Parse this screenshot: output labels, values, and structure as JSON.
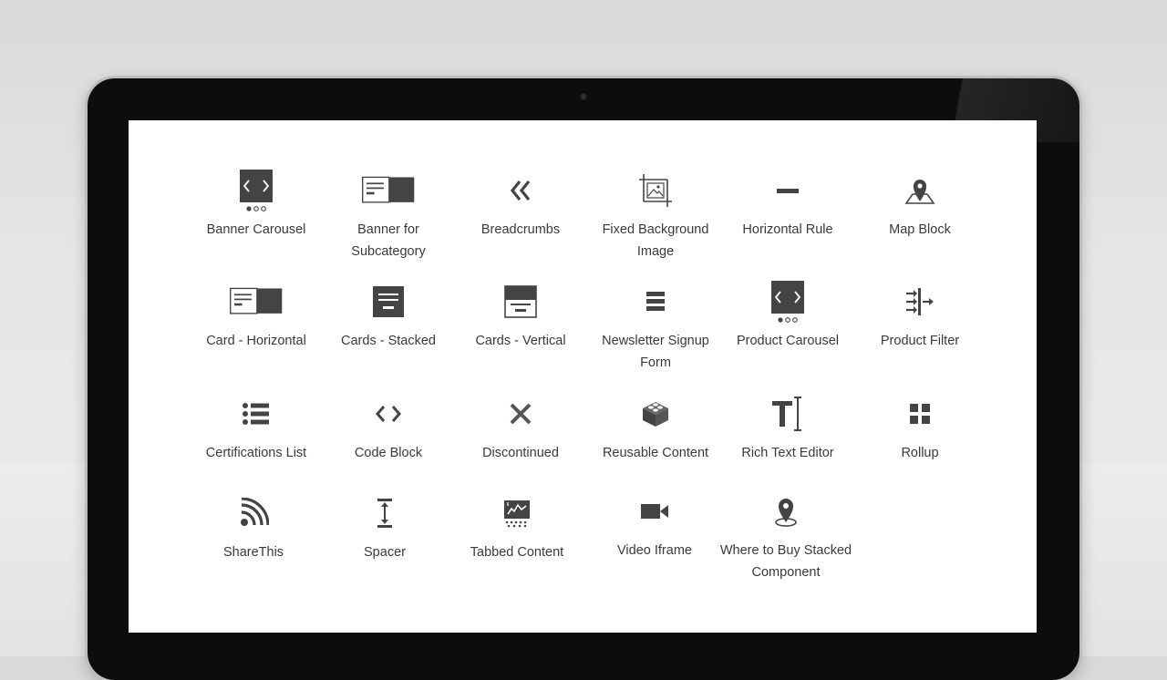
{
  "components": [
    {
      "label": "Banner Carousel",
      "icon": "carousel-icon"
    },
    {
      "label": "Banner for Subcategory",
      "icon": "banner-icon"
    },
    {
      "label": "Breadcrumbs",
      "icon": "double-chevron-left-icon"
    },
    {
      "label": "Fixed Background Image",
      "icon": "crop-image-icon"
    },
    {
      "label": "Horizontal Rule",
      "icon": "minus-icon"
    },
    {
      "label": "Map Block",
      "icon": "map-pin-icon"
    },
    {
      "label": "Card - Horizontal",
      "icon": "card-horizontal-icon"
    },
    {
      "label": "Cards - Stacked",
      "icon": "cards-stacked-icon"
    },
    {
      "label": "Cards - Vertical",
      "icon": "cards-vertical-icon"
    },
    {
      "label": "Newsletter Signup Form",
      "icon": "stacked-bars-icon"
    },
    {
      "label": "Product Carousel",
      "icon": "carousel-icon"
    },
    {
      "label": "Product Filter",
      "icon": "filter-arrows-icon"
    },
    {
      "label": "Certifications List",
      "icon": "list-icon"
    },
    {
      "label": "Code Block",
      "icon": "code-icon"
    },
    {
      "label": "Discontinued",
      "icon": "x-icon"
    },
    {
      "label": "Reusable Content",
      "icon": "lego-block-icon"
    },
    {
      "label": "Rich Text Editor",
      "icon": "text-cursor-icon"
    },
    {
      "label": "Rollup",
      "icon": "grid-squares-icon"
    },
    {
      "label": "ShareThis",
      "icon": "rss-icon"
    },
    {
      "label": "Spacer",
      "icon": "vertical-spacer-icon"
    },
    {
      "label": "Tabbed Content",
      "icon": "tabbed-chart-icon"
    },
    {
      "label": "Video Iframe",
      "icon": "video-camera-icon"
    },
    {
      "label": "Where to Buy Stacked Component",
      "icon": "location-pin-icon"
    }
  ]
}
